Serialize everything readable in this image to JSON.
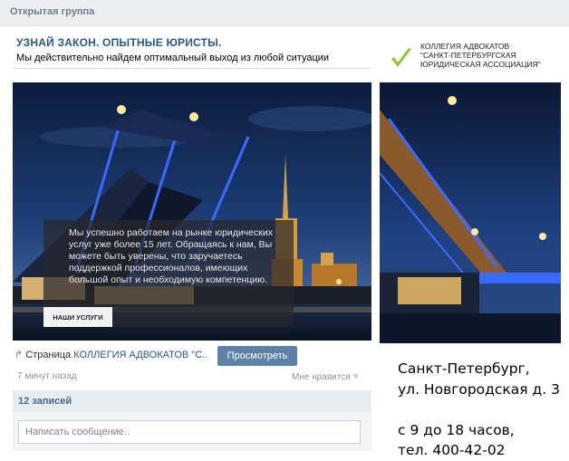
{
  "header": {
    "group_type": "Открытая группа"
  },
  "ad": {
    "title": "УЗНАЙ ЗАКОН. ОПЫТНЫЕ ЮРИСТЫ.",
    "subtitle": "Мы действительно найдем оптимальный выход из любой ситуации",
    "logo_lines": [
      "КОЛЛЕГИЯ АДВОКАТОВ",
      "\"САНКТ-ПЕТЕРБУРГСКАЯ",
      "ЮРИДИЧЕСКАЯ АССОЦИАЦИЯ\""
    ],
    "overlay_text": "Мы успешно работаем на рынке юридических услуг уже более 15 лет. Обращаясь к нам, Вы можете быть уверены, что заручаетесь поддержкой профессионалов, имеющих большой опыт и необходимую компетенцию.",
    "overlay_button": "НАШИ УСЛУГИ"
  },
  "post": {
    "page_prefix": "Страница",
    "page_name": "КОЛЛЕГИЯ АДВОКАТОВ \"С..",
    "view_button": "Просмотреть",
    "time": "7 минут назад",
    "like_label": "Мне нравится"
  },
  "wall": {
    "records_count": "12 записей",
    "message_placeholder": "Написать сообщение.."
  },
  "contact": {
    "lines": [
      "Санкт-Петербург,",
      "ул. Новгородская д. 3",
      "",
      "с 9 до 18 часов,",
      "тел. 400-42-02"
    ]
  },
  "colors": {
    "link": "#2a5885",
    "accent_button": "#5e81a8",
    "logo_check": "#8cc63f"
  }
}
